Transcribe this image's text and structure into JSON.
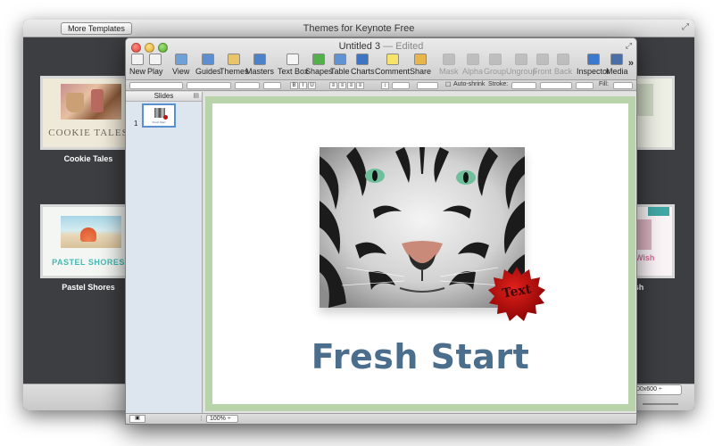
{
  "background_window": {
    "title": "Themes for Keynote Free",
    "more_button": "More Templates",
    "themes": [
      {
        "thumb_title": "COOKIE TALES",
        "label": "Cookie Tales"
      },
      {
        "thumb_title": "PASTEL SHORES",
        "label": "Pastel Shores"
      }
    ],
    "partial_right": [
      {
        "label": ""
      },
      {
        "thumb_text": "Wish",
        "label": "sh"
      }
    ],
    "size_select": "00x600 ÷"
  },
  "document_window": {
    "title": "Untitled 3",
    "status": "— Edited",
    "toolbar": [
      {
        "name": "new",
        "label": "New",
        "color": "#f2f2f2",
        "enabled": true
      },
      {
        "name": "play",
        "label": "Play",
        "color": "#f2f2f2",
        "enabled": true
      },
      {
        "name": "view",
        "label": "View",
        "color": "#6fa1d8",
        "enabled": true
      },
      {
        "name": "guides",
        "label": "Guides",
        "color": "#5b8fd0",
        "enabled": true
      },
      {
        "name": "themes",
        "label": "Themes",
        "color": "#e9c46a",
        "enabled": true
      },
      {
        "name": "masters",
        "label": "Masters",
        "color": "#4c82c9",
        "enabled": true
      },
      {
        "name": "textbox",
        "label": "Text Box",
        "color": "#f4f4f4",
        "enabled": true
      },
      {
        "name": "shapes",
        "label": "Shapes",
        "color": "#54b04a",
        "enabled": true
      },
      {
        "name": "table",
        "label": "Table",
        "color": "#5f93d4",
        "enabled": true
      },
      {
        "name": "charts",
        "label": "Charts",
        "color": "#3d74c4",
        "enabled": true
      },
      {
        "name": "comment",
        "label": "Comment",
        "color": "#f7e36a",
        "enabled": true
      },
      {
        "name": "share",
        "label": "Share",
        "color": "#e8b54a",
        "enabled": true
      },
      {
        "name": "mask",
        "label": "Mask",
        "color": "#9a9a9a",
        "enabled": false
      },
      {
        "name": "alpha",
        "label": "Alpha",
        "color": "#9a9a9a",
        "enabled": false
      },
      {
        "name": "group",
        "label": "Group",
        "color": "#9a9a9a",
        "enabled": false
      },
      {
        "name": "ungroup",
        "label": "Ungroup",
        "color": "#9a9a9a",
        "enabled": false
      },
      {
        "name": "front",
        "label": "Front",
        "color": "#9a9a9a",
        "enabled": false
      },
      {
        "name": "back",
        "label": "Back",
        "color": "#9a9a9a",
        "enabled": false
      },
      {
        "name": "inspector",
        "label": "Inspector",
        "color": "#3b78d0",
        "enabled": true
      },
      {
        "name": "media",
        "label": "Media",
        "color": "#4a6fa8",
        "enabled": true
      }
    ],
    "format_bar": {
      "auto_shrink": "Auto-shrink",
      "stroke_label": "Stroke:",
      "fill_label": "Fill:",
      "bold": "B",
      "italic": "I",
      "underline": "U"
    },
    "slides_panel": {
      "header": "Slides",
      "slides": [
        {
          "number": "1",
          "mini_title": "Fresh Start"
        }
      ]
    },
    "slide": {
      "title": "Fresh Start",
      "seal_text": "Text"
    },
    "zoom": "100%"
  }
}
